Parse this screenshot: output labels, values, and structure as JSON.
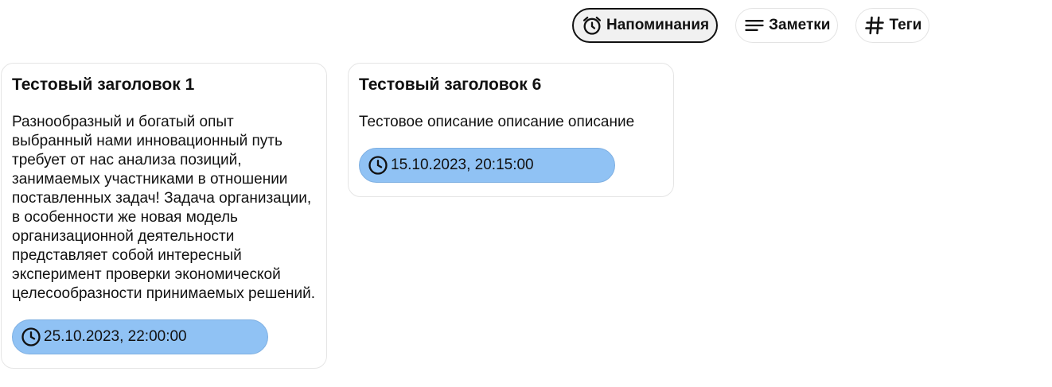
{
  "filters": {
    "items": [
      {
        "label": "Напоминания",
        "icon": "alarm-clock-icon",
        "active": true
      },
      {
        "label": "Заметки",
        "icon": "notes-lines-icon",
        "active": false
      },
      {
        "label": "Теги",
        "icon": "hash-icon",
        "active": false
      }
    ]
  },
  "cards": [
    {
      "title": "Тестовый заголовок 1",
      "text": "Разнообразный и богатый опыт выбранный нами инновационный путь требует от нас анализа позиций, занимаемых участниками в отношении поставленных задач! Задача организации, в особенности же новая модель организационной деятельности представляет собой интересный эксперимент проверки экономической целесообразности принимаемых решений.",
      "reminder": "25.10.2023, 22:00:00",
      "reminder_icon": "clock-icon"
    },
    {
      "title": "Тестовый заголовок 6",
      "text": "Тестовое описание описание описание",
      "reminder": "15.10.2023, 20:15:00",
      "reminder_icon": "clock-icon"
    }
  ],
  "colors": {
    "reminder_pill": "#90c2f4",
    "active_filter_border": "#111111",
    "card_border": "#e5e5e5"
  }
}
